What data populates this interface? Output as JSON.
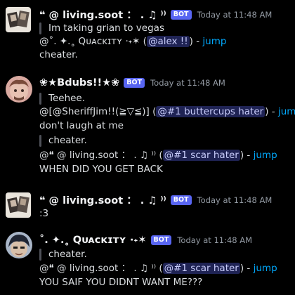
{
  "messages": [
    {
      "username": "❝ @ living.soot ： . ♫ ⁾⁾",
      "badge": "BOT",
      "timestamp": "Today at 11:48 AM",
      "quote": "Im taking grian to vegas",
      "reply_prefix": "@˚. ✦.˳ Qᴜᴀᴄᴋɪᴛʏ ·˖✶ (",
      "mention": "@alex !!",
      "reply_close": ")",
      "jump_sep": " - ",
      "jump": "jump",
      "body": "cheater."
    },
    {
      "username": "❀★Bdubs!!★❀",
      "badge": "BOT",
      "timestamp": "Today at 11:48 AM",
      "quote": "Teehee.",
      "reply_prefix": "@[@SheriffJim!!(≧▽≦)] (",
      "mention": "@#1 buttercups hater",
      "reply_close": ")",
      "jump_sep": " - ",
      "jump": "jump",
      "body": " don't laugh at me",
      "quote2": "cheater.",
      "reply2_prefix": "@❝  @  living.soot  ：  . ♫ ⁾⁾ (",
      "mention2": "@#1 scar hater",
      "reply2_close": ")",
      "body2": " WHEN DID YOU GET BACK"
    },
    {
      "username": "❝ @ living.soot ： . ♫ ⁾⁾",
      "badge": "BOT",
      "timestamp": "Today at 11:48 AM",
      "body": ":3"
    },
    {
      "username": "˚. ✦.˳ Qᴜᴀᴄᴋɪᴛʏ ·˖✶",
      "badge": "BOT",
      "timestamp": "Today at 11:48 AM",
      "quote": "cheater.",
      "reply_prefix": "@❝  @  living.soot  ：  . ♫ ⁾⁾ (",
      "mention": "@#1 scar hater",
      "reply_close": ")",
      "jump_sep": " - ",
      "jump": "jump",
      "body": "YOU SAIF YOU DIDNT WANT ME???"
    }
  ],
  "colors": {
    "background": "#000000",
    "bot_badge": "#5865f2",
    "link": "#00a8fc",
    "mention_bg": "#3c4270"
  },
  "icons": [
    "soot-avatar",
    "bdubs-avatar",
    "quackity-avatar"
  ]
}
